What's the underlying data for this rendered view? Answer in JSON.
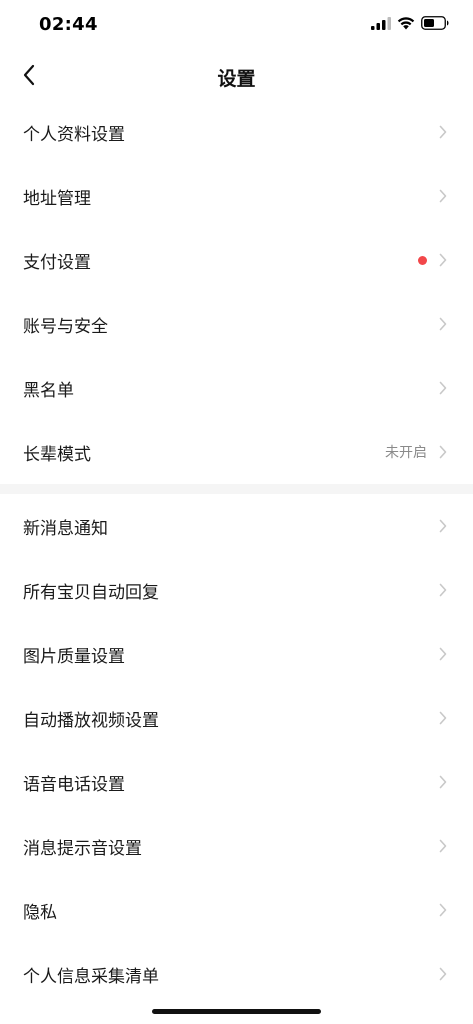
{
  "status_bar": {
    "time": "02:44",
    "icons": [
      "signal-icon",
      "wifi-icon",
      "battery-icon"
    ]
  },
  "nav": {
    "title": "设置",
    "back_icon": "chevron-left-icon"
  },
  "section1": {
    "items": [
      {
        "label": "个人资料设置"
      },
      {
        "label": "地址管理"
      },
      {
        "label": "支付设置",
        "badge": "red-dot"
      },
      {
        "label": "账号与安全"
      },
      {
        "label": "黑名单"
      },
      {
        "label": "长辈模式",
        "value": "未开启"
      }
    ]
  },
  "section2": {
    "items": [
      {
        "label": "新消息通知"
      },
      {
        "label": "所有宝贝自动回复"
      },
      {
        "label": "图片质量设置"
      },
      {
        "label": "自动播放视频设置"
      },
      {
        "label": "语音电话设置"
      },
      {
        "label": "消息提示音设置"
      },
      {
        "label": "隐私"
      },
      {
        "label": "个人信息采集清单"
      }
    ]
  },
  "colors": {
    "badge": "#f2474a",
    "chevron": "#c8c8c8",
    "divider_bg": "#f5f5f5",
    "secondary_text": "#8a8a8a"
  }
}
